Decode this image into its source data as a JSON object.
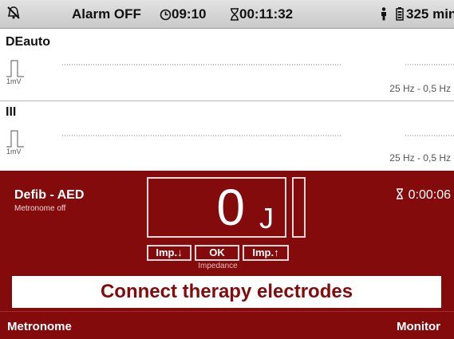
{
  "status_bar": {
    "alarm_icon": "alarm-off-bell-icon",
    "alarm_status": "Alarm OFF",
    "clock_icon": "clock-icon",
    "time": "09:10",
    "timer_icon": "hourglass-icon",
    "elapsed": "00:11:32",
    "patient_icon": "adult-patient-icon",
    "battery_icon": "battery-icon",
    "battery_remaining": "325 min"
  },
  "leads": [
    {
      "label": "DEauto",
      "scale": "1mV",
      "filter": "25 Hz - 0,5 Hz"
    },
    {
      "label": "III",
      "scale": "1mV",
      "filter": "25 Hz - 0,5 Hz"
    }
  ],
  "defib": {
    "mode": "Defib - AED",
    "metronome_status": "Metronome off",
    "energy_value": "0",
    "energy_unit": "J",
    "timer_icon": "hourglass-icon",
    "elapsed": "0:00:06",
    "buttons": {
      "imp_down": "Imp.↓",
      "ok": "OK",
      "imp_up": "Imp.↑"
    },
    "impedance_label": "Impedance",
    "message": "Connect therapy electrodes"
  },
  "softkeys": {
    "left": "Metronome",
    "right": "Monitor"
  },
  "colors": {
    "defib_background": "#830b0b",
    "status_background": "#d4d4d4"
  }
}
